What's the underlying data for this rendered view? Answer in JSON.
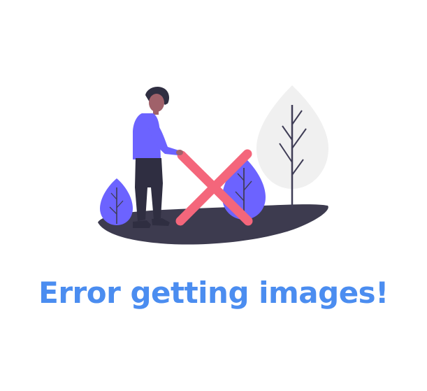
{
  "error": {
    "message": "Error getting images!"
  },
  "illustration": {
    "icon": "person-with-cross-illustration"
  },
  "colors": {
    "message_text": "#4b8df0",
    "ground": "#3d3b4f",
    "shirt": "#6c63ff",
    "cross": "#f4667b",
    "tree_light": "#f0f0f0",
    "tree_dark_branch": "#3f3d56",
    "bush_purple": "#6c63ff"
  }
}
